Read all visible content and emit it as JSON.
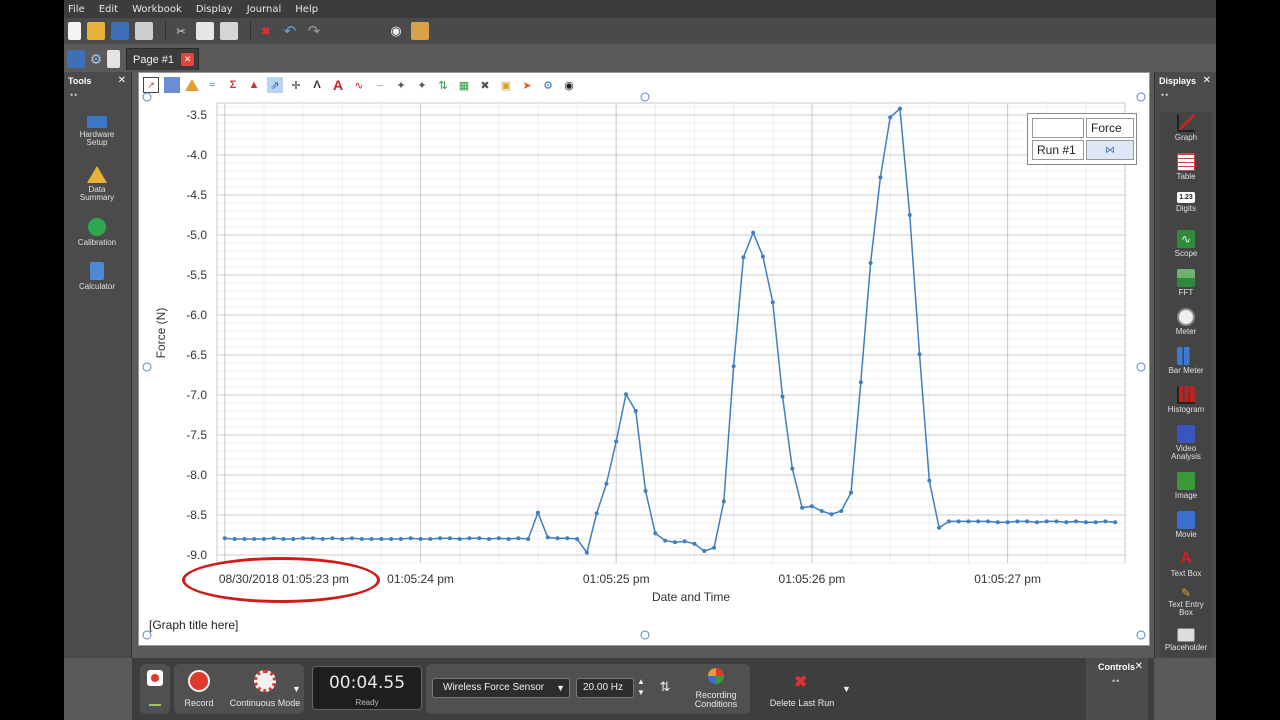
{
  "menu": [
    "File",
    "Edit",
    "Workbook",
    "Display",
    "Journal",
    "Help"
  ],
  "page_tab": {
    "label": "Page #1"
  },
  "tools": {
    "title": "Tools",
    "items": [
      {
        "label_line1": "Hardware",
        "label_line2": "Setup"
      },
      {
        "label_line1": "Data",
        "label_line2": "Summary"
      },
      {
        "label_line1": "Calibration",
        "label_line2": ""
      },
      {
        "label_line1": "Calculator",
        "label_line2": ""
      }
    ]
  },
  "displays": {
    "title": "Displays",
    "items": [
      {
        "label_line1": "Graph",
        "label_line2": ""
      },
      {
        "label_line1": "Table",
        "label_line2": ""
      },
      {
        "label_line1": "Digits",
        "label_line2": ""
      },
      {
        "label_line1": "Scope",
        "label_line2": ""
      },
      {
        "label_line1": "FFT",
        "label_line2": ""
      },
      {
        "label_line1": "Meter",
        "label_line2": ""
      },
      {
        "label_line1": "Bar Meter",
        "label_line2": ""
      },
      {
        "label_line1": "Histogram",
        "label_line2": ""
      },
      {
        "label_line1": "Video",
        "label_line2": "Analysis"
      },
      {
        "label_line1": "Image",
        "label_line2": ""
      },
      {
        "label_line1": "Movie",
        "label_line2": ""
      },
      {
        "label_line1": "Text Box",
        "label_line2": ""
      },
      {
        "label_line1": "Text Entry",
        "label_line2": "Box"
      },
      {
        "label_line1": "Placeholder",
        "label_line2": ""
      }
    ]
  },
  "graph": {
    "legend_measurement": "Force",
    "legend_run": "Run #1",
    "title_placeholder": "[Graph title here]"
  },
  "chart_data": {
    "type": "line",
    "xlabel": "Date and Time",
    "ylabel": "Force (N)",
    "ylim": [
      -9.1,
      -3.35
    ],
    "y_ticks": [
      -3.5,
      -4.0,
      -4.5,
      -5.0,
      -5.5,
      -6.0,
      -6.5,
      -7.0,
      -7.5,
      -8.0,
      -8.5,
      -9.0
    ],
    "x_tick_labels": [
      "08/30/2018 01:05:23 pm",
      "01:05:24 pm",
      "01:05:25 pm",
      "01:05:26 pm",
      "01:05:27 pm"
    ],
    "x_tick_seconds": [
      0,
      1,
      2,
      3,
      4
    ],
    "xlim": [
      -0.04,
      4.6
    ],
    "series": [
      {
        "name": "Force",
        "color": "#3f7fc0",
        "x": [
          0.0,
          0.05,
          0.1,
          0.15,
          0.2,
          0.25,
          0.3,
          0.35,
          0.4,
          0.45,
          0.5,
          0.55,
          0.6,
          0.65,
          0.7,
          0.75,
          0.8,
          0.85,
          0.9,
          0.95,
          1.0,
          1.05,
          1.1,
          1.15,
          1.2,
          1.25,
          1.3,
          1.35,
          1.4,
          1.45,
          1.5,
          1.55,
          1.6,
          1.65,
          1.7,
          1.75,
          1.8,
          1.85,
          1.9,
          1.95,
          2.0,
          2.05,
          2.1,
          2.15,
          2.2,
          2.25,
          2.3,
          2.35,
          2.4,
          2.45,
          2.5,
          2.55,
          2.6,
          2.65,
          2.7,
          2.75,
          2.8,
          2.85,
          2.9,
          2.95,
          3.0,
          3.05,
          3.1,
          3.15,
          3.2,
          3.25,
          3.3,
          3.35,
          3.4,
          3.45,
          3.5,
          3.55,
          3.6,
          3.65,
          3.7,
          3.75,
          3.8,
          3.85,
          3.9,
          3.95,
          4.0,
          4.05,
          4.1,
          4.15,
          4.2,
          4.25,
          4.3,
          4.35,
          4.4,
          4.45,
          4.5,
          4.55
        ],
        "values": [
          -8.79,
          -8.8,
          -8.8,
          -8.8,
          -8.8,
          -8.79,
          -8.8,
          -8.8,
          -8.79,
          -8.79,
          -8.8,
          -8.79,
          -8.8,
          -8.79,
          -8.8,
          -8.8,
          -8.8,
          -8.8,
          -8.8,
          -8.79,
          -8.8,
          -8.8,
          -8.79,
          -8.79,
          -8.8,
          -8.79,
          -8.79,
          -8.8,
          -8.79,
          -8.8,
          -8.79,
          -8.8,
          -8.47,
          -8.78,
          -8.79,
          -8.79,
          -8.8,
          -8.97,
          -8.48,
          -8.11,
          -7.58,
          -6.99,
          -7.2,
          -8.2,
          -8.73,
          -8.82,
          -8.84,
          -8.83,
          -8.86,
          -8.95,
          -8.91,
          -8.33,
          -6.64,
          -5.28,
          -4.97,
          -5.27,
          -5.84,
          -7.02,
          -7.92,
          -8.41,
          -8.39,
          -8.45,
          -8.49,
          -8.45,
          -8.22,
          -6.84,
          -5.35,
          -4.28,
          -3.53,
          -3.42,
          -4.75,
          -6.49,
          -8.07,
          -8.66,
          -8.58,
          -8.58,
          -8.58,
          -8.58,
          -8.58,
          -8.59,
          -8.59,
          -8.58,
          -8.58,
          -8.59,
          -8.58,
          -8.58,
          -8.59,
          -8.58,
          -8.59,
          -8.59,
          -8.58,
          -8.59
        ]
      }
    ]
  },
  "controls": {
    "record_label": "Record",
    "mode_label": "Continuous Mode",
    "timer_value": "00:04.55",
    "timer_status": "Ready",
    "sensor": "Wireless Force Sensor",
    "sample_rate": "20.00 Hz",
    "recording_conditions_line1": "Recording",
    "recording_conditions_line2": "Conditions",
    "delete_last_run": "Delete Last Run",
    "panel_title": "Controls"
  },
  "colors": {
    "accent_red": "#d11b1b",
    "series_blue": "#3f7fc0",
    "record_red": "#e03a2c"
  }
}
